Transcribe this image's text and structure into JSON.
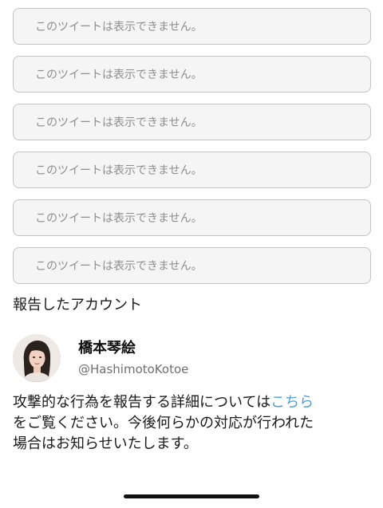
{
  "reported_tweets": [
    {
      "text": "このツイートは表示できません。"
    },
    {
      "text": "このツイートは表示できません。"
    },
    {
      "text": "このツイートは表示できません。"
    },
    {
      "text": "このツイートは表示できません。"
    },
    {
      "text": "このツイートは表示できません。"
    },
    {
      "text": "このツイートは表示できません。"
    }
  ],
  "reported_account_section": {
    "title": "報告したアカウント",
    "name": "橋本琴絵",
    "handle": "@HashimotoKotoe"
  },
  "info": {
    "line1": "攻撃的な行為を報告する詳細については",
    "link_text": "こちら",
    "line2": "をご覧ください。今後何らかの対応が行われた",
    "line3": "場合はお知らせいたします。"
  },
  "colors": {
    "link": "#4a9fd8",
    "box_border": "#c4c4c4",
    "box_fill": "#f5f5f5",
    "muted_text": "#8e8e8e"
  }
}
